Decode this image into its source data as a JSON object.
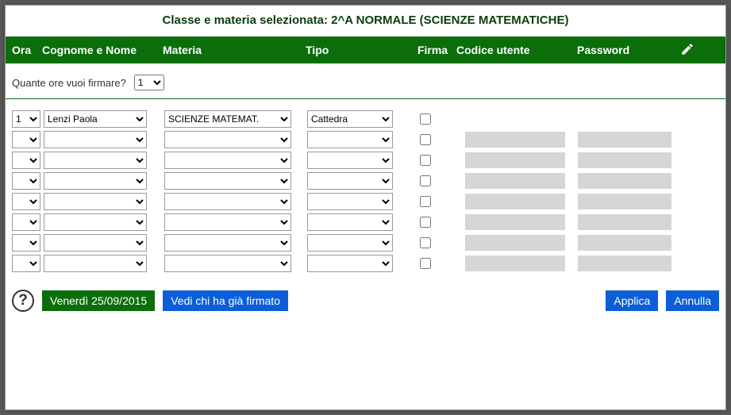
{
  "title": "Classe e materia selezionata: 2^A NORMALE (SCIENZE MATEMATICHE)",
  "headers": {
    "ora": "Ora",
    "nome": "Cognome e Nome",
    "materia": "Materia",
    "tipo": "Tipo",
    "firma": "Firma",
    "codice": "Codice utente",
    "password": "Password"
  },
  "subhead": {
    "label": "Quante ore vuoi firmare?",
    "value": "1"
  },
  "rows": [
    {
      "ora": "1",
      "nome": "Lenzi Paola",
      "materia": "SCIENZE MATEMAT.",
      "tipo": "Cattedra",
      "firma": false,
      "codice": "",
      "password": "",
      "showInputs": false
    },
    {
      "ora": "",
      "nome": "",
      "materia": "",
      "tipo": "",
      "firma": false,
      "codice": "",
      "password": "",
      "showInputs": true
    },
    {
      "ora": "",
      "nome": "",
      "materia": "",
      "tipo": "",
      "firma": false,
      "codice": "",
      "password": "",
      "showInputs": true
    },
    {
      "ora": "",
      "nome": "",
      "materia": "",
      "tipo": "",
      "firma": false,
      "codice": "",
      "password": "",
      "showInputs": true
    },
    {
      "ora": "",
      "nome": "",
      "materia": "",
      "tipo": "",
      "firma": false,
      "codice": "",
      "password": "",
      "showInputs": true
    },
    {
      "ora": "",
      "nome": "",
      "materia": "",
      "tipo": "",
      "firma": false,
      "codice": "",
      "password": "",
      "showInputs": true
    },
    {
      "ora": "",
      "nome": "",
      "materia": "",
      "tipo": "",
      "firma": false,
      "codice": "",
      "password": "",
      "showInputs": true
    },
    {
      "ora": "",
      "nome": "",
      "materia": "",
      "tipo": "",
      "firma": false,
      "codice": "",
      "password": "",
      "showInputs": true
    }
  ],
  "footer": {
    "date": "Venerdì 25/09/2015",
    "viewSigned": "Vedi chi ha già firmato",
    "apply": "Applica",
    "cancel": "Annulla"
  }
}
